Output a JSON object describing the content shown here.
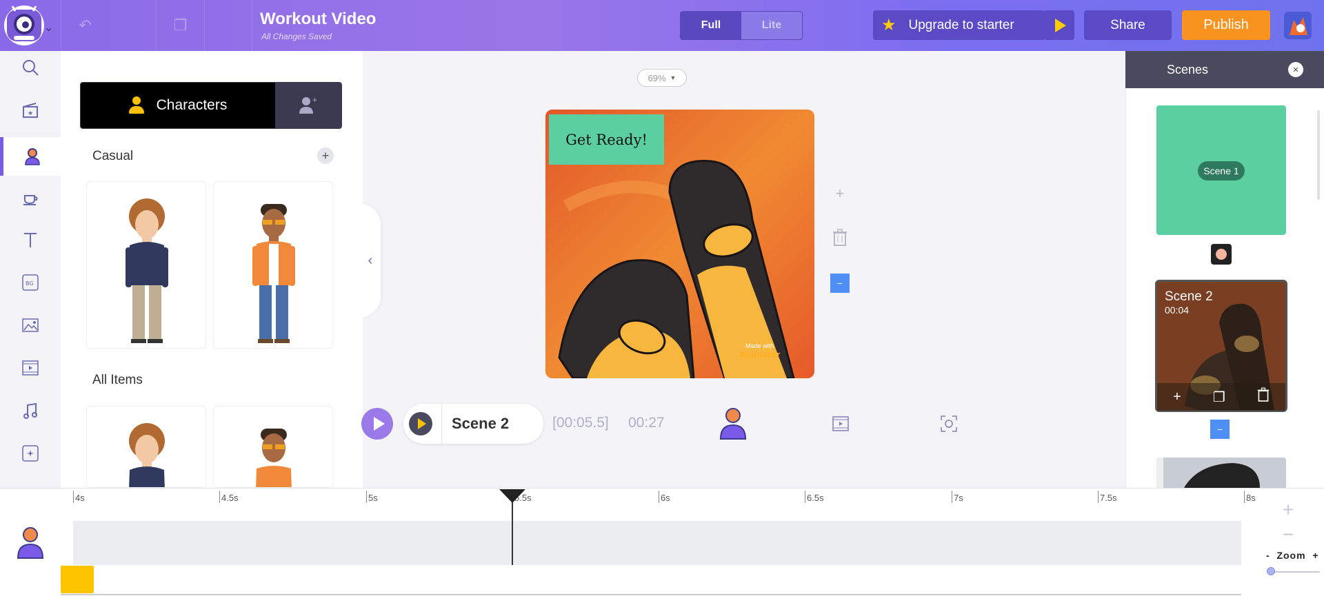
{
  "header": {
    "title": "Workout Video",
    "subtitle": "All Changes Saved",
    "mode_full": "Full",
    "mode_lite": "Lite",
    "upgrade_label": "Upgrade to starter",
    "share_label": "Share",
    "publish_label": "Publish"
  },
  "colors": {
    "accent": "#8a6ae8",
    "publish": "#f7931e",
    "scene_green": "#5ccfa0",
    "highlight_blue": "#4d8ff5"
  },
  "left_rail": [
    "search-icon",
    "scene-library-icon",
    "character-icon",
    "props-icon",
    "text-icon",
    "background-icon",
    "image-icon",
    "video-icon",
    "music-icon",
    "effects-icon"
  ],
  "panel": {
    "tab_active": "Characters",
    "section_casual": "Casual",
    "section_all": "All Items"
  },
  "stage": {
    "zoom": "69%",
    "canvas_text": "Get Ready!",
    "watermark_top": "Made with",
    "watermark_brand": "Animaker",
    "scene_label": "Scene 2",
    "current_time": "[00:05.5]",
    "total_time": "00:27"
  },
  "scenes_panel": {
    "header": "Scenes",
    "close_symbol": "×",
    "scene1_label": "Scene 1",
    "scene2_title": "Scene 2",
    "scene2_time": "00:04"
  },
  "timeline": {
    "ticks": [
      "4s",
      "4.5s",
      "5s",
      "5.5s",
      "6s",
      "6.5s",
      "7s",
      "7.5s",
      "8s"
    ],
    "zoom_label": "Zoom",
    "zoom_minus": "-",
    "zoom_plus": "+"
  }
}
